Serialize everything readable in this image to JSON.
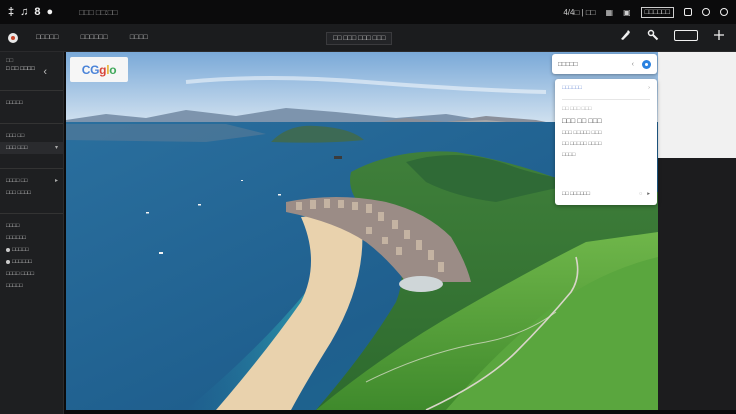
{
  "status_bar": {
    "left_glyphs": [
      "‡",
      "♫",
      "8",
      "●"
    ],
    "time": "□□□ □□:□□",
    "right_text_1": "4/4□ | □□",
    "badge": "□□□□□□"
  },
  "toolbar": {
    "menu": [
      "□□□□□",
      "□□□□□□",
      "□□□□"
    ],
    "center_label": "□□ □□□ □□□ □□□"
  },
  "sidebar": {
    "header_line1": "□□",
    "header_line2": "□ □□ □□□□",
    "rows": [
      "□□□□□",
      "□□□ □□",
      "□□□ □□□",
      "□□□□ □□",
      "□□□ □□□□",
      "□□□□",
      "□□□□□□",
      "□□□□□",
      "□□□□□□",
      "□□□□ □□□□",
      "□□□□□"
    ]
  },
  "brand": {
    "letters": [
      "G",
      "g",
      "l",
      "o"
    ],
    "prefix": "C"
  },
  "search": {
    "value": "□□□□□"
  },
  "info_card": {
    "header": "□□□□□□",
    "sub": "□□ □□□ □□□",
    "title": "□□□ □□ □□□",
    "lines": [
      "□□□ □□□□□ □□□",
      "□□ □□□□□ □□□□",
      "□□□□"
    ],
    "footer": "□□ □□□□□□"
  },
  "colors": {
    "sea_deep": "#1f5f8e",
    "sea_shallow": "#3cc3c0",
    "sand": "#e9d2ad",
    "grass": "#4f9a3a",
    "sky": "#8fb8de",
    "accent_blue": "#2b82e0"
  },
  "icons": {
    "toolbar": [
      "pen-icon",
      "brush-icon",
      "panel-icon",
      "plus-icon"
    ]
  }
}
